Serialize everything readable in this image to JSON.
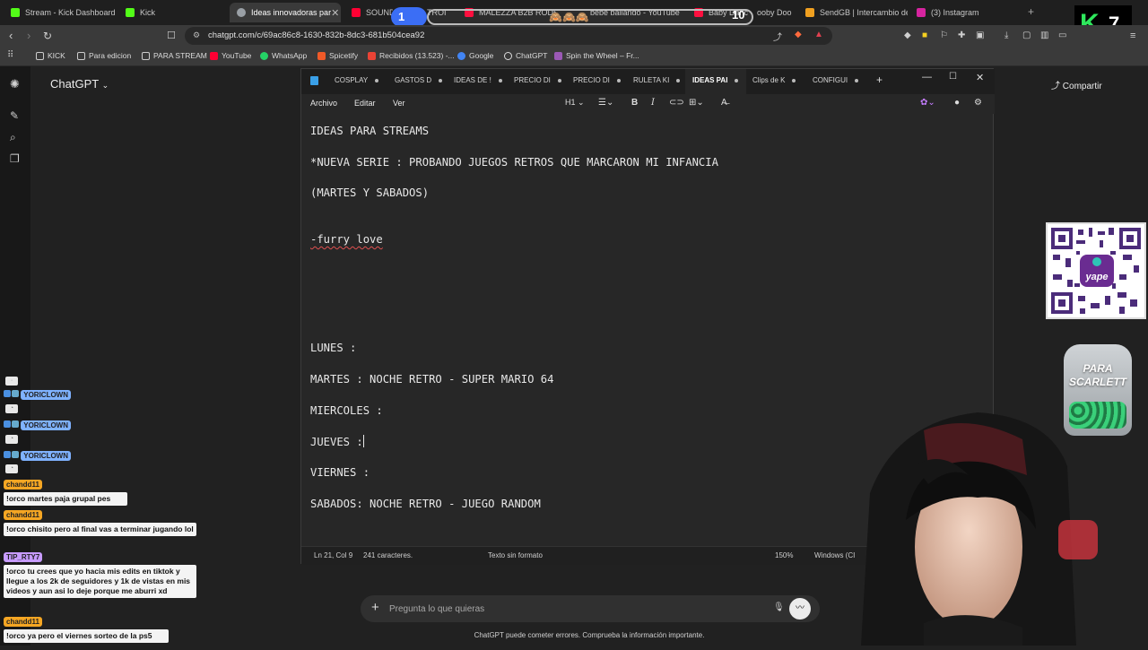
{
  "browser": {
    "tabs": [
      {
        "label": "Stream - Kick Dashboard",
        "color": "#53fc18"
      },
      {
        "label": "Kick",
        "color": "#53fc18"
      },
      {
        "label": "Ideas innovadoras par",
        "color": "#9aa0a6",
        "active": true
      },
      {
        "label": "SOUNDT",
        "color": "#ff0033"
      },
      {
        "label": "TROI",
        "color": "#ff0033"
      },
      {
        "label": "MALEZZA B2B RODRIG",
        "color": "#ff0033"
      },
      {
        "label": "bebe bailando - YouTube",
        "color": "#ff0033"
      },
      {
        "label": "Baby Danc",
        "color": "#ff0033"
      },
      {
        "label": "ooby Doo",
        "color": "#ff0033"
      },
      {
        "label": "SendGB | Intercambio de",
        "color": "#f0a020"
      },
      {
        "label": "(3) Instagram",
        "color": "#d6249f"
      }
    ],
    "url": "chatgpt.com/c/69ac86c8-1630-832b-8dc3-681b504cea92",
    "bookmarks": [
      {
        "label": "KICK",
        "color": "#cccccc"
      },
      {
        "label": "Para edicion",
        "color": "#cccccc"
      },
      {
        "label": "PARA STREAM",
        "color": "#cccccc"
      },
      {
        "label": "YouTube",
        "color": "#ff0033"
      },
      {
        "label": "WhatsApp",
        "color": "#25d366"
      },
      {
        "label": "Spicetify",
        "color": "#f05a28"
      },
      {
        "label": "Recibidos (13.523) -...",
        "color": "#ea4335"
      },
      {
        "label": "Google",
        "color": "#4285f4"
      },
      {
        "label": "ChatGPT",
        "color": "#dddddd"
      },
      {
        "label": "Spin the Wheel – Fr...",
        "color": "#9b59b6"
      }
    ]
  },
  "chatgpt": {
    "title": "ChatGPT",
    "share_label": "Compartir",
    "prompt_placeholder": "Pregunta lo que quieras",
    "disclaimer": "ChatGPT puede cometer errores. Comprueba la información importante."
  },
  "notepad": {
    "tabs": [
      "COSPLAY",
      "GASTOS D",
      "IDEAS DE !",
      "PRECIO DI",
      "PRECIO DI",
      "RULETA KI",
      "IDEAS PAI",
      "Clips de K",
      "CONFIGUI"
    ],
    "active_tab_index": 6,
    "menu": [
      "Archivo",
      "Editar",
      "Ver"
    ],
    "heading_select": "H1",
    "lines": [
      "IDEAS PARA STREAMS",
      "*NUEVA SERIE : PROBANDO JUEGOS RETROS QUE MARCARON MI INFANCIA",
      "(MARTES Y SABADOS)",
      "-furry love",
      "LUNES :",
      "MARTES : NOCHE RETRO - SUPER MARIO 64",
      "MIERCOLES :",
      "JUEVES :",
      "VIERNES :",
      "SABADOS: NOCHE RETRO - JUEGO RANDOM"
    ],
    "status": {
      "position": "Ln 21, Col 9",
      "chars": "241 caracteres.",
      "format": "Texto sin formato",
      "zoom": "150%",
      "eol": "Windows (CI"
    }
  },
  "stream_chat": [
    {
      "user": "YORICLOWN",
      "user_color": "#7fb2ff",
      "msg": ""
    },
    {
      "user": "YORICLOWN",
      "user_color": "#7fb2ff",
      "msg": ""
    },
    {
      "user": "YORICLOWN",
      "user_color": "#7fb2ff",
      "msg": ""
    },
    {
      "user": "chandd11",
      "user_color": "#f5a623",
      "msg": "!orco martes paja grupal pes"
    },
    {
      "user": "chandd11",
      "user_color": "#f5a623",
      "msg": "!orco chisito pero al final vas a terminar jugando lol"
    },
    {
      "user": "TIP_RTY7",
      "user_color": "#c79bff",
      "msg": "!orco tu crees que yo hacia mis edits en tiktok y llegue a los 2k de seguidores y 1k de vistas en mis videos y aun asi lo deje porque me aburri xd"
    },
    {
      "user": "chandd11",
      "user_color": "#f5a623",
      "msg": "!orco ya pero el viernes sorteo de la ps5"
    }
  ],
  "overlays": {
    "counter_left": "1",
    "counter_right": "10",
    "kick_letter": "K",
    "kick_count": "7",
    "jar_text": "PARA SCARLETT",
    "qr_label": "yape"
  }
}
